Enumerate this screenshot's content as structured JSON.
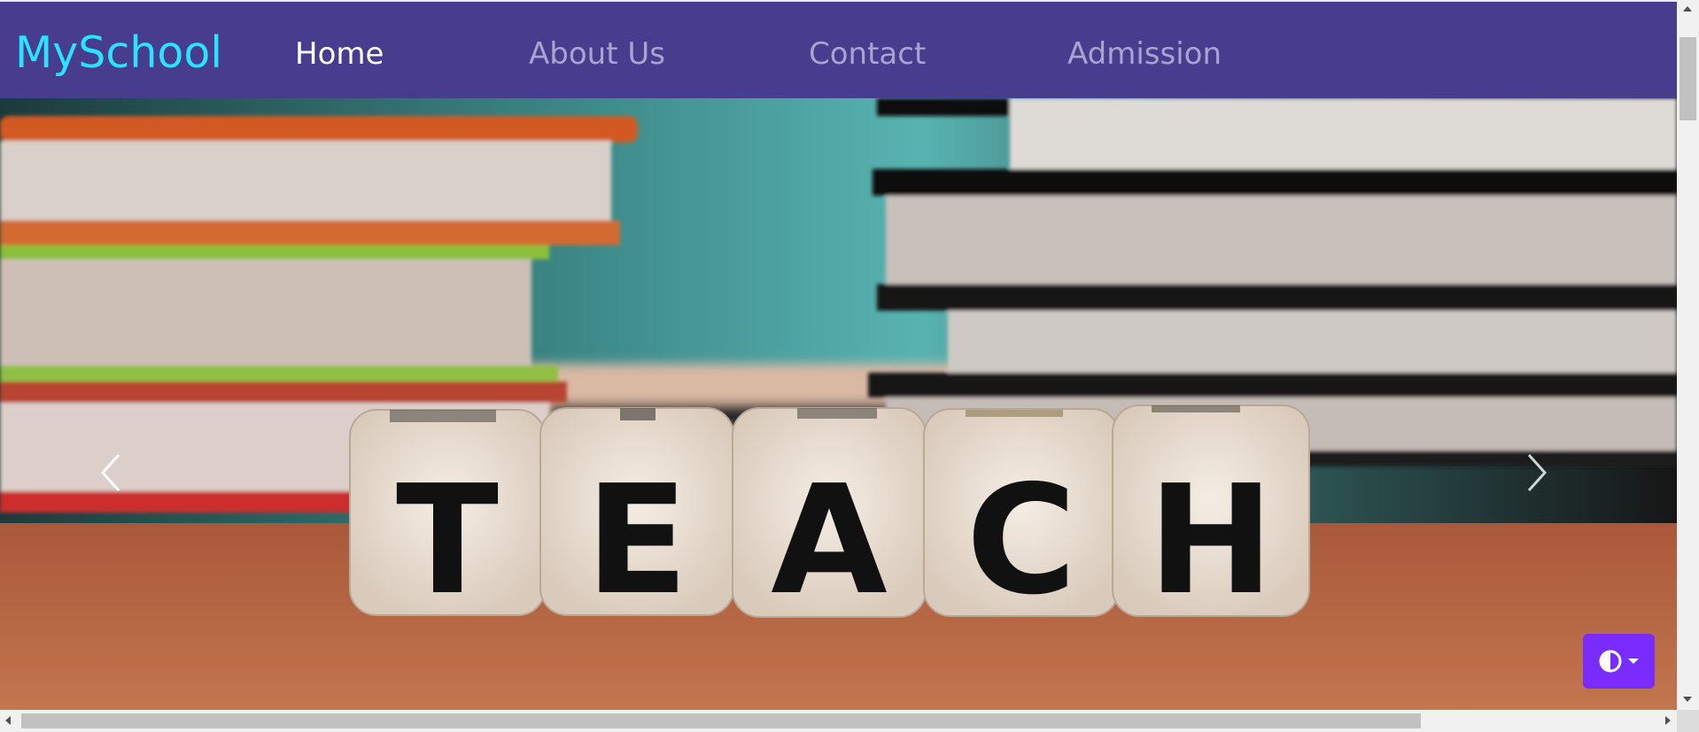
{
  "navbar": {
    "brand": "MySchool",
    "links": [
      {
        "label": "Home",
        "active": true
      },
      {
        "label": "About Us",
        "active": false
      },
      {
        "label": "Contact",
        "active": false
      },
      {
        "label": "Admission",
        "active": false
      }
    ]
  },
  "hero": {
    "dice_letters": [
      "T",
      "E",
      "A",
      "C",
      "H"
    ]
  },
  "icons": {
    "prev": "chevron-left-icon",
    "next": "chevron-right-icon",
    "theme": "half-circle-contrast-icon",
    "caret": "caret-down-icon"
  },
  "colors": {
    "navbar": "#473c8d",
    "brand": "#2ce3ff",
    "nav_active": "#ffffff",
    "nav_inactive": "#a8a4cf",
    "toggle": "#7a2cff"
  }
}
